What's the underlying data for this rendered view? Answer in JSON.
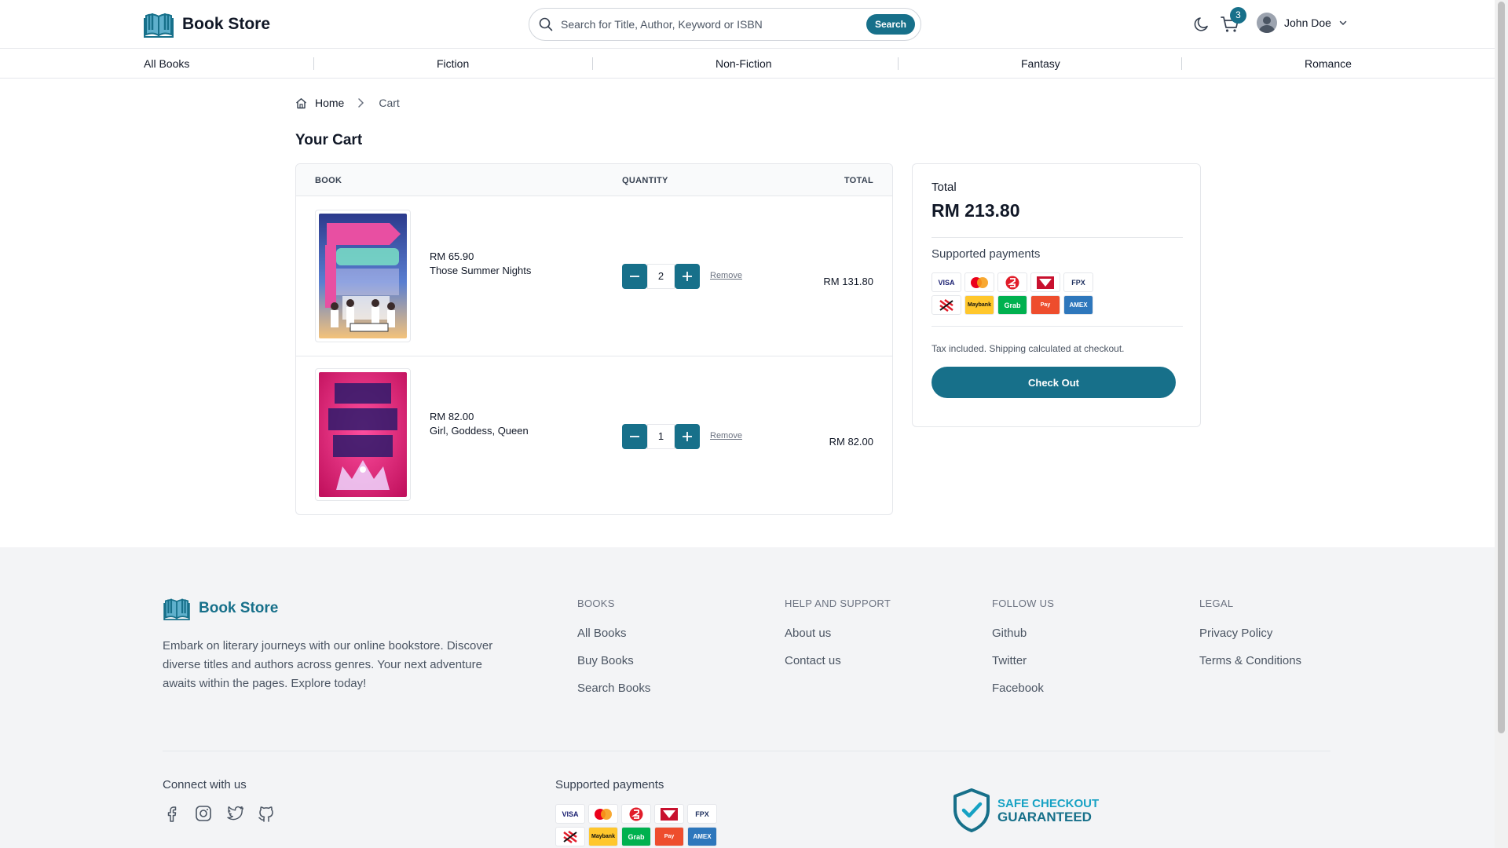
{
  "header": {
    "logo_text": "Book Store",
    "search_placeholder": "Search for Title, Author, Keyword or ISBN",
    "search_button": "Search",
    "cart_count": "3",
    "user_name": "John Doe"
  },
  "categories": [
    "All Books",
    "Fiction",
    "Non-Fiction",
    "Fantasy",
    "Romance"
  ],
  "breadcrumb": {
    "home": "Home",
    "current": "Cart"
  },
  "page_title": "Your Cart",
  "cart": {
    "columns": {
      "book": "BOOK",
      "quantity": "QUANTITY",
      "total": "TOTAL"
    },
    "items": [
      {
        "price": "RM 65.90",
        "title": "Those Summer Nights",
        "quantity": "2",
        "remove": "Remove",
        "line_total": "RM 131.80"
      },
      {
        "price": "RM 82.00",
        "title": "Girl, Goddess, Queen",
        "quantity": "1",
        "remove": "Remove",
        "line_total": "RM 82.00"
      }
    ]
  },
  "summary": {
    "total_label": "Total",
    "total_value": "RM 213.80",
    "payments_label": "Supported payments",
    "tax_note": "Tax included. Shipping calculated at checkout.",
    "checkout_button": "Check Out"
  },
  "payment_methods": [
    {
      "icon": "visa-logo",
      "label": "VISA",
      "color": "#1a1f71",
      "bg": "#ffffff"
    },
    {
      "icon": "mastercard-logo",
      "label": "",
      "color": "#eb001b",
      "bg": "#ffffff"
    },
    {
      "icon": "bank-logo",
      "label": "",
      "color": "#e11d2a",
      "bg": "#ffffff"
    },
    {
      "icon": "bank-flag-logo",
      "label": "",
      "color": "#c8102e",
      "bg": "#ffffff"
    },
    {
      "icon": "fpx-logo",
      "label": "FPX",
      "color": "#1d2f5e",
      "bg": "#ffffff"
    },
    {
      "icon": "bank-stripes-logo",
      "label": "",
      "color": "#e11d2a",
      "bg": "#ffffff"
    },
    {
      "icon": "maybank-logo",
      "label": "Maybank",
      "color": "#111111",
      "bg": "#ffc72c"
    },
    {
      "icon": "grab-logo",
      "label": "Grab",
      "color": "#ffffff",
      "bg": "#00b14f"
    },
    {
      "icon": "shopeepay-logo",
      "label": "Pay",
      "color": "#ffffff",
      "bg": "#ee4d2d"
    },
    {
      "icon": "amex-logo",
      "label": "AMEX",
      "color": "#ffffff",
      "bg": "#2e77bc"
    }
  ],
  "footer": {
    "logo_text": "Book Store",
    "description": "Embark on literary journeys with our online bookstore. Discover diverse titles and authors across genres. Your next adventure awaits within the pages. Explore today!",
    "columns": [
      {
        "heading": "BOOKS",
        "links": [
          "All Books",
          "Buy Books",
          "Search Books"
        ]
      },
      {
        "heading": "HELP AND SUPPORT",
        "links": [
          "About us",
          "Contact us"
        ]
      },
      {
        "heading": "FOLLOW US",
        "links": [
          "Github",
          "Twitter",
          "Facebook"
        ]
      },
      {
        "heading": "LEGAL",
        "links": [
          "Privacy Policy",
          "Terms & Conditions"
        ]
      }
    ],
    "connect_label": "Connect with us",
    "social_icons": [
      "facebook-icon",
      "instagram-icon",
      "twitter-icon",
      "github-icon"
    ],
    "payments_label": "Supported payments",
    "safe_line1": "SAFE CHECKOUT",
    "safe_line2": "GUARANTEED"
  },
  "colors": {
    "accent": "#17708a",
    "footer_bg": "#f3f4f6",
    "border": "#e5e7eb"
  }
}
